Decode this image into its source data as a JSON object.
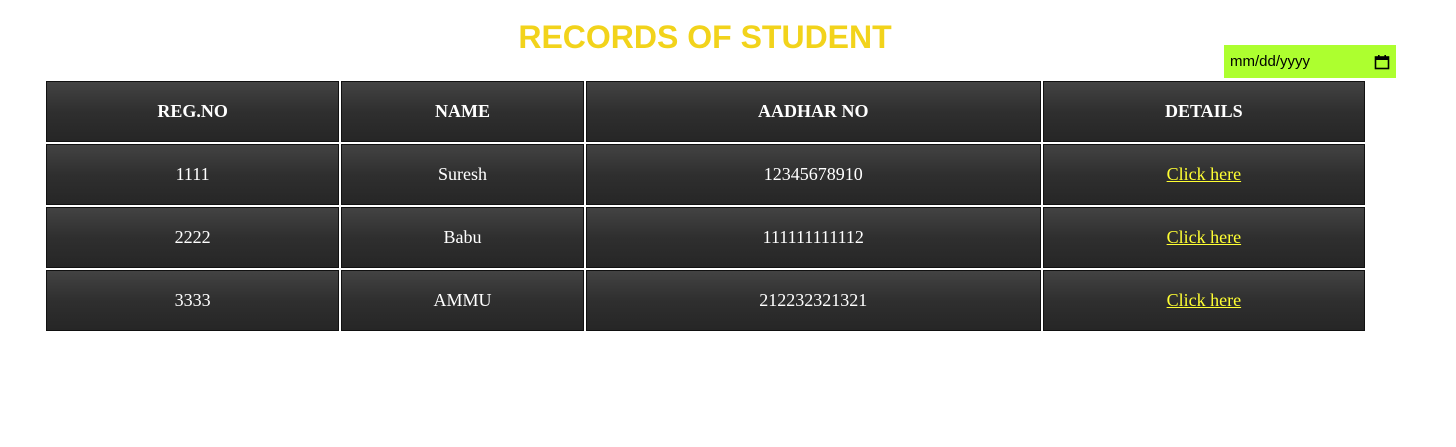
{
  "page": {
    "title": "RECORDS OF STUDENT",
    "accent_color": "#f2d31b"
  },
  "date_input": {
    "value": "mm/dd/yyyy",
    "icon": "calendar-icon",
    "background": "#adff2f"
  },
  "table": {
    "headers": [
      "REG.NO",
      "NAME",
      "AADHAR NO",
      "DETAILS"
    ],
    "rows": [
      {
        "reg_no": "1111",
        "name": "Suresh",
        "aadhar": "12345678910",
        "details": "Click here"
      },
      {
        "reg_no": "2222",
        "name": "Babu",
        "aadhar": "111111111112",
        "details": "Click here"
      },
      {
        "reg_no": "3333",
        "name": "AMMU",
        "aadhar": "212232321321",
        "details": "Click here"
      }
    ],
    "link_color": "#ffff33"
  }
}
